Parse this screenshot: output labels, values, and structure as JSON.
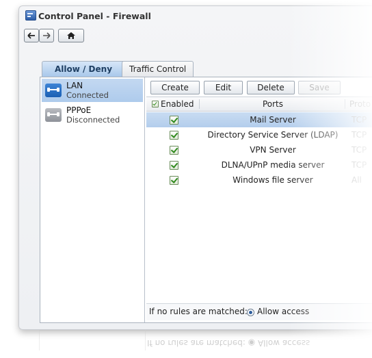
{
  "window": {
    "title": "Control Panel - Firewall"
  },
  "nav": {
    "back": "back-arrow",
    "forward": "forward-arrow",
    "home": "home"
  },
  "tabs": [
    {
      "label": "Allow / Deny",
      "active": true
    },
    {
      "label": "Traffic Control",
      "active": false
    }
  ],
  "interfaces": [
    {
      "name": "LAN",
      "status": "Connected",
      "selected": true
    },
    {
      "name": "PPPoE",
      "status": "Disconnected",
      "selected": false
    }
  ],
  "toolbar": {
    "create": "Create",
    "edit": "Edit",
    "delete": "Delete",
    "save": "Save"
  },
  "table": {
    "headers": {
      "enabled": "Enabled",
      "ports": "Ports",
      "protocol": "Proto"
    },
    "rows": [
      {
        "enabled": true,
        "ports": "Mail Server",
        "protocol": "TCP",
        "selected": true
      },
      {
        "enabled": true,
        "ports": "Directory Service Server (LDAP)",
        "protocol": "TCP",
        "selected": false
      },
      {
        "enabled": true,
        "ports": "VPN Server",
        "protocol": "TCP",
        "selected": false
      },
      {
        "enabled": true,
        "ports": "DLNA/UPnP media server",
        "protocol": "TCP",
        "selected": false
      },
      {
        "enabled": true,
        "ports": "Windows file server",
        "protocol": "All",
        "selected": false
      }
    ]
  },
  "footer": {
    "label": "If no rules are matched:",
    "allow": "Allow access",
    "reflection": "If no rules are matched: ◉ Allow access"
  },
  "colors": {
    "selection": "#b3cdec",
    "accent": "#2e5ea8"
  }
}
